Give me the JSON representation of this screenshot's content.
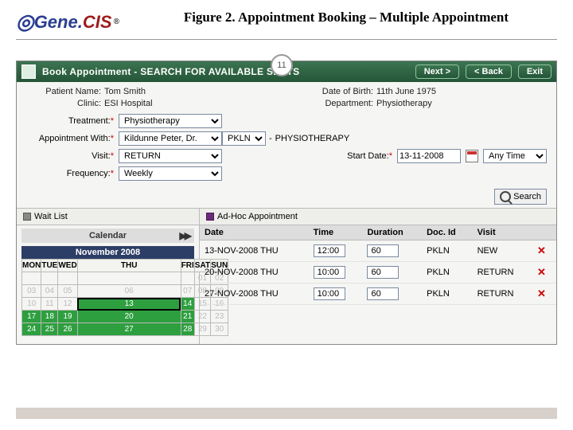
{
  "figure": {
    "title": "Figure 2. Appointment Booking – Multiple Appointment",
    "page": "11"
  },
  "logo": {
    "part1": "Gene.",
    "part2": "CIS",
    "reg": "®"
  },
  "titlebar": {
    "title": "Book Appointment - SEARCH FOR AVAILABLE SLOTS",
    "next": "Next >",
    "back": "< Back",
    "exit": "Exit"
  },
  "patient": {
    "name_lbl": "Patient Name:",
    "name": "Tom Smith",
    "clinic_lbl": "Clinic:",
    "clinic": "ESI Hospital",
    "dob_lbl": "Date of Birth:",
    "dob": "11th June 1975",
    "dept_lbl": "Department:",
    "dept": "Physiotherapy"
  },
  "form": {
    "treatment_lbl": "Treatment:",
    "treatment": "Physiotherapy",
    "apptwith_lbl": "Appointment With:",
    "doctor": "Kildunne Peter, Dr.",
    "code": "PKLN",
    "specialty": "PHYSIOTHERAPY",
    "visit_lbl": "Visit:",
    "visit": "RETURN",
    "start_lbl": "Start Date:",
    "start_date": "13-11-2008",
    "anytime": "Any Time",
    "freq_lbl": "Frequency:",
    "freq": "Weekly",
    "search": "Search",
    "req": "*"
  },
  "midbar": {
    "waitlist": "Wait List",
    "adhoc": "Ad-Hoc Appointment"
  },
  "calendar": {
    "header": "Calendar",
    "month": "November 2008",
    "days": [
      "MON",
      "TUE",
      "WED",
      "THU",
      "FRI",
      "SAT",
      "SUN"
    ],
    "rows": [
      [
        {
          "n": "",
          "c": "dim"
        },
        {
          "n": "",
          "c": "dim"
        },
        {
          "n": "",
          "c": "dim"
        },
        {
          "n": "",
          "c": "dim"
        },
        {
          "n": "",
          "c": "dim"
        },
        {
          "n": "01",
          "c": "dim"
        },
        {
          "n": "02",
          "c": "dim"
        }
      ],
      [
        {
          "n": "03",
          "c": "dim"
        },
        {
          "n": "04",
          "c": "dim"
        },
        {
          "n": "05",
          "c": "dim"
        },
        {
          "n": "06",
          "c": "dim"
        },
        {
          "n": "07",
          "c": "dim"
        },
        {
          "n": "08",
          "c": "dim"
        },
        {
          "n": "09",
          "c": "dim"
        }
      ],
      [
        {
          "n": "10",
          "c": "dim"
        },
        {
          "n": "11",
          "c": "dim"
        },
        {
          "n": "12",
          "c": "dim"
        },
        {
          "n": "13",
          "c": "sel"
        },
        {
          "n": "14",
          "c": "busy"
        },
        {
          "n": "15",
          "c": "dim"
        },
        {
          "n": "16",
          "c": "dim"
        }
      ],
      [
        {
          "n": "17",
          "c": "busy"
        },
        {
          "n": "18",
          "c": "busy"
        },
        {
          "n": "19",
          "c": "busy"
        },
        {
          "n": "20",
          "c": "busy"
        },
        {
          "n": "21",
          "c": "busy"
        },
        {
          "n": "22",
          "c": "dim"
        },
        {
          "n": "23",
          "c": "dim"
        }
      ],
      [
        {
          "n": "24",
          "c": "busy"
        },
        {
          "n": "25",
          "c": "busy"
        },
        {
          "n": "26",
          "c": "busy"
        },
        {
          "n": "27",
          "c": "busy"
        },
        {
          "n": "28",
          "c": "busy"
        },
        {
          "n": "29",
          "c": "dim"
        },
        {
          "n": "30",
          "c": "dim"
        }
      ]
    ]
  },
  "grid": {
    "cols": {
      "date": "Date",
      "time": "Time",
      "duration": "Duration",
      "docid": "Doc. Id",
      "visit": "Visit",
      "del": ""
    },
    "rows": [
      {
        "date": "13-NOV-2008 THU",
        "time": "12:00",
        "duration": "60",
        "docid": "PKLN",
        "visit": "NEW"
      },
      {
        "date": "20-NOV-2008 THU",
        "time": "10:00",
        "duration": "60",
        "docid": "PKLN",
        "visit": "RETURN"
      },
      {
        "date": "27-NOV-2008 THU",
        "time": "10:00",
        "duration": "60",
        "docid": "PKLN",
        "visit": "RETURN"
      }
    ],
    "delete_glyph": "✕"
  }
}
